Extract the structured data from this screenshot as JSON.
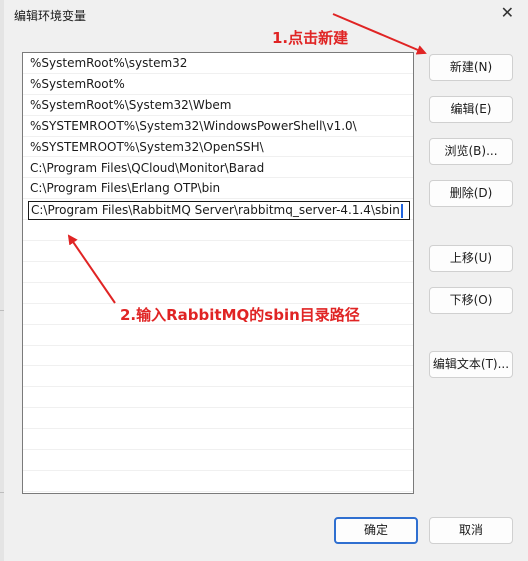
{
  "dialog": {
    "title": "编辑环境变量",
    "close_glyph": "✕"
  },
  "list": {
    "items": [
      "%SystemRoot%\\system32",
      "%SystemRoot%",
      "%SystemRoot%\\System32\\Wbem",
      "%SYSTEMROOT%\\System32\\WindowsPowerShell\\v1.0\\",
      "%SYSTEMROOT%\\System32\\OpenSSH\\",
      "C:\\Program Files\\QCloud\\Monitor\\Barad",
      "C:\\Program Files\\Erlang OTP\\bin"
    ],
    "editing_value": "C:\\Program Files\\RabbitMQ Server\\rabbitmq_server-4.1.4\\sbin"
  },
  "buttons": {
    "new": "新建(N)",
    "edit": "编辑(E)",
    "browse": "浏览(B)...",
    "delete": "删除(D)",
    "move_up": "上移(U)",
    "move_down": "下移(O)",
    "edit_text": "编辑文本(T)...",
    "ok": "确定",
    "cancel": "取消"
  },
  "annotations": {
    "step1": "1.点击新建",
    "step2": "2.输入RabbitMQ的sbin目录路径",
    "color": "#e02424"
  },
  "colors": {
    "primary_border": "#2f6fd0",
    "caret": "#1f63e0"
  }
}
